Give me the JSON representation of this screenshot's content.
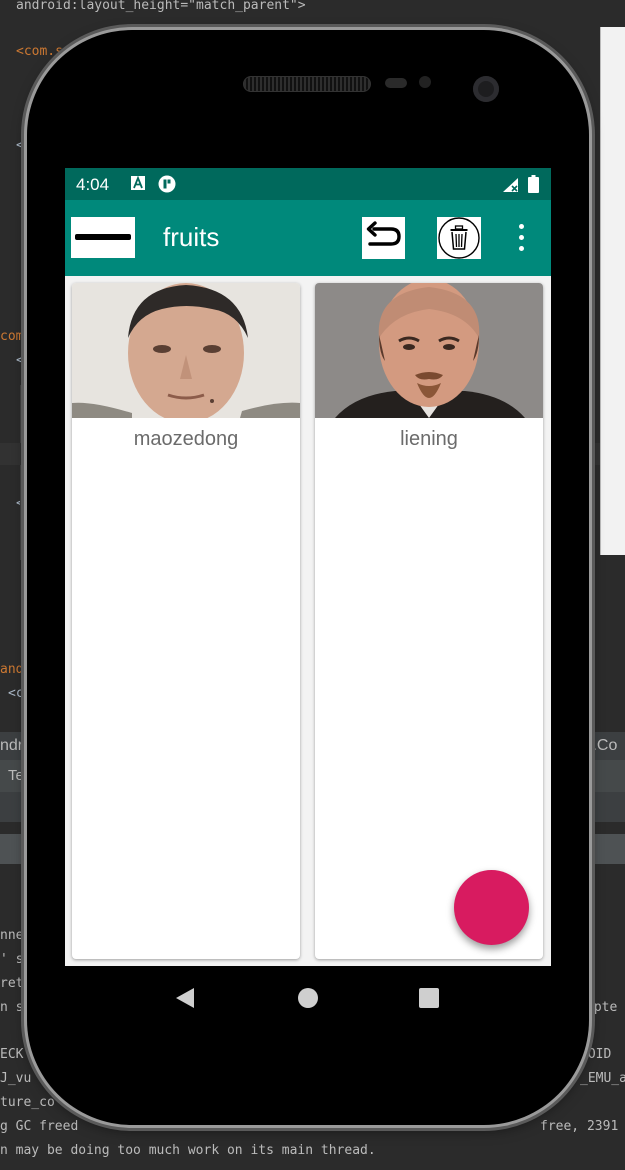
{
  "ide": {
    "code_top": "android:layout_height=\"match_parent\">",
    "code_com_s": "<com.s",
    "code_lt1": "<",
    "code_com": "com",
    "code_lt2": "<",
    "code_lt3": "<",
    "code_and": "and",
    "code_c": "<c",
    "tab_left": "ndro",
    "tab_right": "t.Co",
    "tab_te": "Te",
    "log_lines": [
      "nnec",
      "' si",
      "retu",
      "n sh",
      "ECK",
      "J_vu",
      "ture_co",
      "g GC freed",
      "n may be doing too much work on its main thread."
    ],
    "log_right": [
      "mpte",
      "ROID",
      "_EMU_a",
      "free, 2391"
    ]
  },
  "status_bar": {
    "time": "4:04"
  },
  "app_bar": {
    "title": "fruits"
  },
  "cards": [
    {
      "name": "maozedong"
    },
    {
      "name": "liening"
    }
  ],
  "icons": {
    "nav": "menu-bar-icon",
    "undo": "undo-icon",
    "delete": "trash-icon",
    "overflow": "more-vert-icon"
  },
  "colors": {
    "status_bar": "#00695c",
    "app_bar": "#00897b",
    "fab": "#d81b60"
  }
}
